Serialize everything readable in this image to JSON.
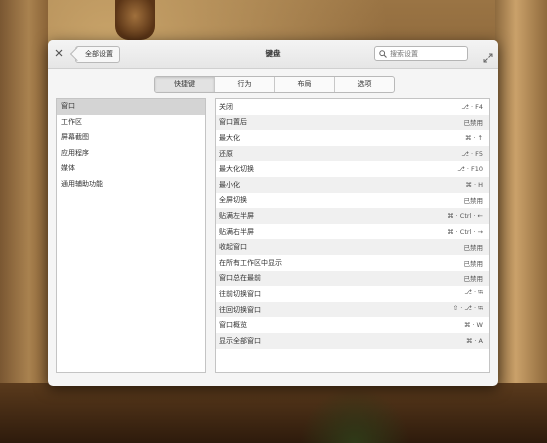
{
  "window": {
    "title": "键盘",
    "back_label": "全部设置",
    "search_placeholder": "搜索设置"
  },
  "tabs": [
    {
      "label": "快捷键",
      "active": true
    },
    {
      "label": "行为",
      "active": false
    },
    {
      "label": "布局",
      "active": false
    },
    {
      "label": "选项",
      "active": false
    }
  ],
  "categories": [
    {
      "label": "窗口",
      "selected": true
    },
    {
      "label": "工作区",
      "selected": false
    },
    {
      "label": "屏幕截图",
      "selected": false
    },
    {
      "label": "应用程序",
      "selected": false
    },
    {
      "label": "媒体",
      "selected": false
    },
    {
      "label": "通用辅助功能",
      "selected": false
    }
  ],
  "shortcuts": [
    {
      "action": "关闭",
      "keys": "⎇ · F4"
    },
    {
      "action": "窗口置后",
      "keys": "已禁用"
    },
    {
      "action": "最大化",
      "keys": "⌘ · ↑"
    },
    {
      "action": "还原",
      "keys": "⎇ · F5"
    },
    {
      "action": "最大化切换",
      "keys": "⎇ · F10"
    },
    {
      "action": "最小化",
      "keys": "⌘ · H"
    },
    {
      "action": "全屏切换",
      "keys": "已禁用"
    },
    {
      "action": "贴满左半屏",
      "keys": "⌘ · Ctrl · ←"
    },
    {
      "action": "贴满右半屏",
      "keys": "⌘ · Ctrl · →"
    },
    {
      "action": "收起窗口",
      "keys": "已禁用"
    },
    {
      "action": "在所有工作区中显示",
      "keys": "已禁用"
    },
    {
      "action": "窗口总在最前",
      "keys": "已禁用"
    },
    {
      "action": "往前切换窗口",
      "keys": "⎇ · ⭾"
    },
    {
      "action": "往回切换窗口",
      "keys": "⇧ · ⎇ · ⭾"
    },
    {
      "action": "窗口概览",
      "keys": "⌘ · W"
    },
    {
      "action": "显示全部窗口",
      "keys": "⌘ · A"
    }
  ],
  "icons": {
    "close": "close-icon",
    "search": "search-icon",
    "maximize": "maximize-icon"
  }
}
